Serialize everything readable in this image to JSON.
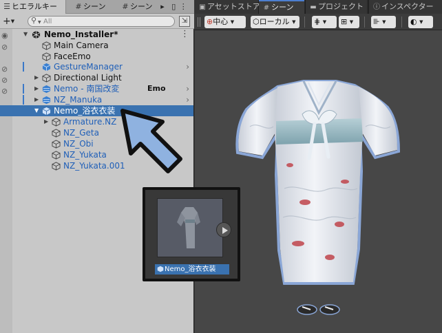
{
  "hierarchy": {
    "tab_label": "ヒエラルキー",
    "scene_tab_1": "シーン",
    "scene_tab_2": "シーン",
    "add_label": "+",
    "search_placeholder": "All",
    "root": "Nemo_Installer*",
    "items": [
      {
        "label": "Main Camera",
        "color": "#111111"
      },
      {
        "label": "FaceEmo",
        "color": "#111111"
      },
      {
        "label": "GestureManager",
        "color": "#1f5fb8"
      },
      {
        "label": "Directional Light",
        "color": "#111111"
      },
      {
        "label": "Nemo - 南国改変",
        "color": "#1f5fb8"
      },
      {
        "label": "NZ_Manuka",
        "color": "#1f5fb8"
      },
      {
        "label": "Nemo_浴衣衣装",
        "color": "#ffffff"
      },
      {
        "label": "Armature.NZ",
        "color": "#1f5fb8"
      },
      {
        "label": "NZ_Geta",
        "color": "#1f5fb8"
      },
      {
        "label": "NZ_Obi",
        "color": "#1f5fb8"
      },
      {
        "label": "NZ_Yukata",
        "color": "#1f5fb8"
      },
      {
        "label": "NZ_Yukata.001",
        "color": "#1f5fb8"
      }
    ],
    "emo_tag": "Emo"
  },
  "thumbnail": {
    "label": "Nemo_浴衣衣装"
  },
  "scene": {
    "tabs": {
      "asset_store": "アセットストア",
      "scene": "シーン",
      "project": "プロジェクト",
      "inspector": "インスペクター"
    },
    "toolbar": {
      "pivot": "中心",
      "space": "ローカル"
    }
  },
  "colors": {
    "selection": "#3a72b0",
    "prefab_blue": "#1f5fb8",
    "arrow_fill": "#8fb2e0"
  }
}
